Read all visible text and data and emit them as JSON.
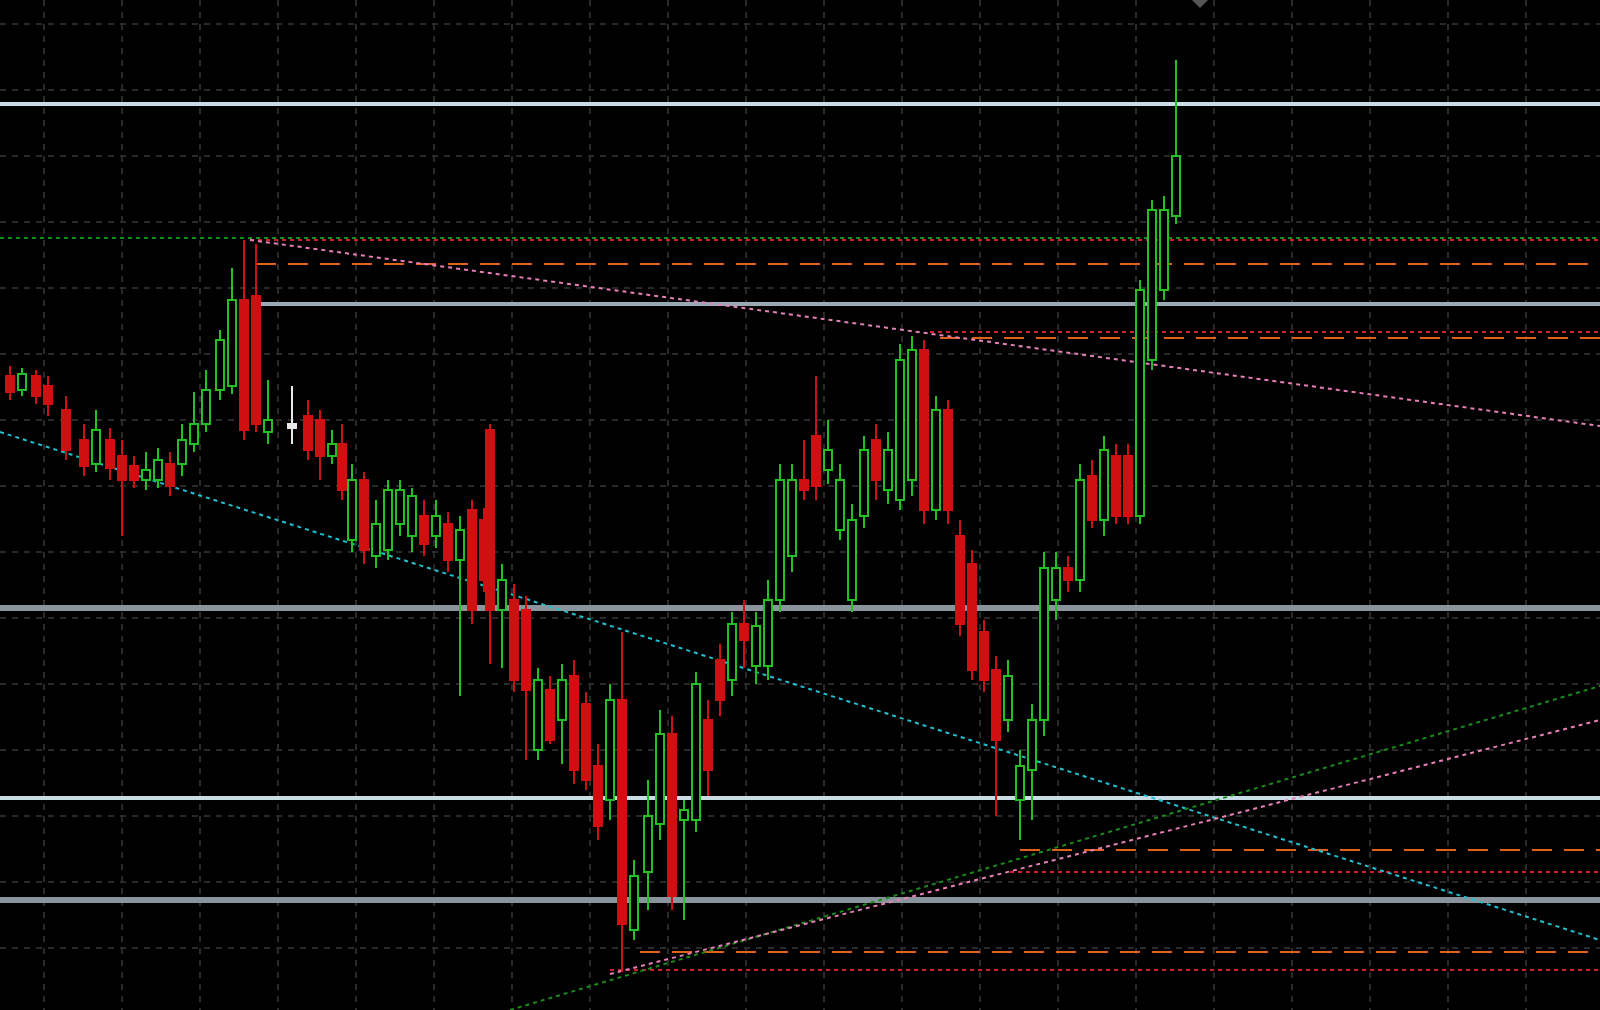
{
  "chart": {
    "kind": "candlestick"
  }
}
